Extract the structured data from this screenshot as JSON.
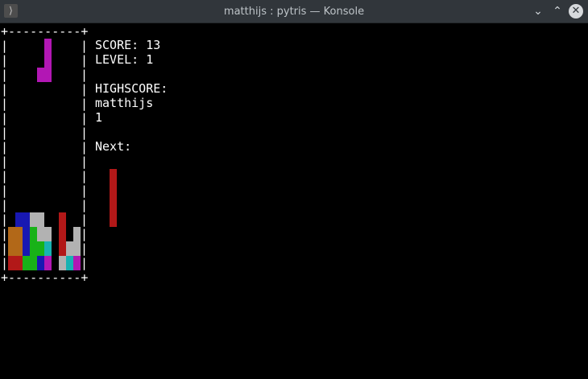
{
  "window": {
    "title": "matthijs : pytris — Konsole",
    "icon": "terminal-icon",
    "buttons": {
      "minimize": "chevron-down-icon",
      "maximize": "chevron-up-icon",
      "close": "close-icon"
    }
  },
  "board": {
    "top_border": "+----------+",
    "bottom_border": "+----------+",
    "side_char": "|"
  },
  "info": {
    "score_label": "SCORE:",
    "score": "13",
    "level_label": "LEVEL:",
    "level": "1",
    "highscore_label": "HIGHSCORE:",
    "highscore_name": "matthijs",
    "highscore_value": "1",
    "next_label": "Next:"
  },
  "colors": {
    "magenta": "#b217b4",
    "red": "#b21818",
    "blue": "#1818b2",
    "green": "#18b218",
    "gray": "#b2b2b2",
    "orange": "#b26818",
    "cyan": "#18b2b2"
  },
  "falling_piece": {
    "color": "magenta",
    "cells": [
      [
        6,
        1
      ],
      [
        6,
        2
      ],
      [
        6,
        3
      ],
      [
        5,
        3
      ]
    ]
  },
  "stack": [
    {
      "col": 2,
      "row": 13,
      "color": "blue"
    },
    {
      "col": 3,
      "row": 13,
      "color": "blue"
    },
    {
      "col": 4,
      "row": 13,
      "color": "gray"
    },
    {
      "col": 5,
      "row": 13,
      "color": "gray"
    },
    {
      "col": 8,
      "row": 13,
      "color": "red"
    },
    {
      "col": 1,
      "row": 14,
      "color": "orange"
    },
    {
      "col": 2,
      "row": 14,
      "color": "orange"
    },
    {
      "col": 3,
      "row": 14,
      "color": "blue"
    },
    {
      "col": 4,
      "row": 14,
      "color": "green"
    },
    {
      "col": 5,
      "row": 14,
      "color": "gray"
    },
    {
      "col": 6,
      "row": 14,
      "color": "gray"
    },
    {
      "col": 8,
      "row": 14,
      "color": "red"
    },
    {
      "col": 10,
      "row": 14,
      "color": "gray"
    },
    {
      "col": 1,
      "row": 15,
      "color": "orange"
    },
    {
      "col": 2,
      "row": 15,
      "color": "orange"
    },
    {
      "col": 3,
      "row": 15,
      "color": "blue"
    },
    {
      "col": 4,
      "row": 15,
      "color": "green"
    },
    {
      "col": 5,
      "row": 15,
      "color": "green"
    },
    {
      "col": 6,
      "row": 15,
      "color": "cyan"
    },
    {
      "col": 8,
      "row": 15,
      "color": "red"
    },
    {
      "col": 9,
      "row": 15,
      "color": "gray"
    },
    {
      "col": 10,
      "row": 15,
      "color": "gray"
    },
    {
      "col": 1,
      "row": 16,
      "color": "red"
    },
    {
      "col": 2,
      "row": 16,
      "color": "red"
    },
    {
      "col": 3,
      "row": 16,
      "color": "green"
    },
    {
      "col": 4,
      "row": 16,
      "color": "green"
    },
    {
      "col": 5,
      "row": 16,
      "color": "blue"
    },
    {
      "col": 6,
      "row": 16,
      "color": "magenta"
    },
    {
      "col": 8,
      "row": 16,
      "color": "gray"
    },
    {
      "col": 9,
      "row": 16,
      "color": "cyan"
    },
    {
      "col": 10,
      "row": 16,
      "color": "magenta"
    }
  ],
  "next_piece": {
    "color": "red",
    "cells": [
      [
        0,
        0
      ],
      [
        0,
        1
      ],
      [
        0,
        2
      ],
      [
        0,
        3
      ]
    ]
  }
}
